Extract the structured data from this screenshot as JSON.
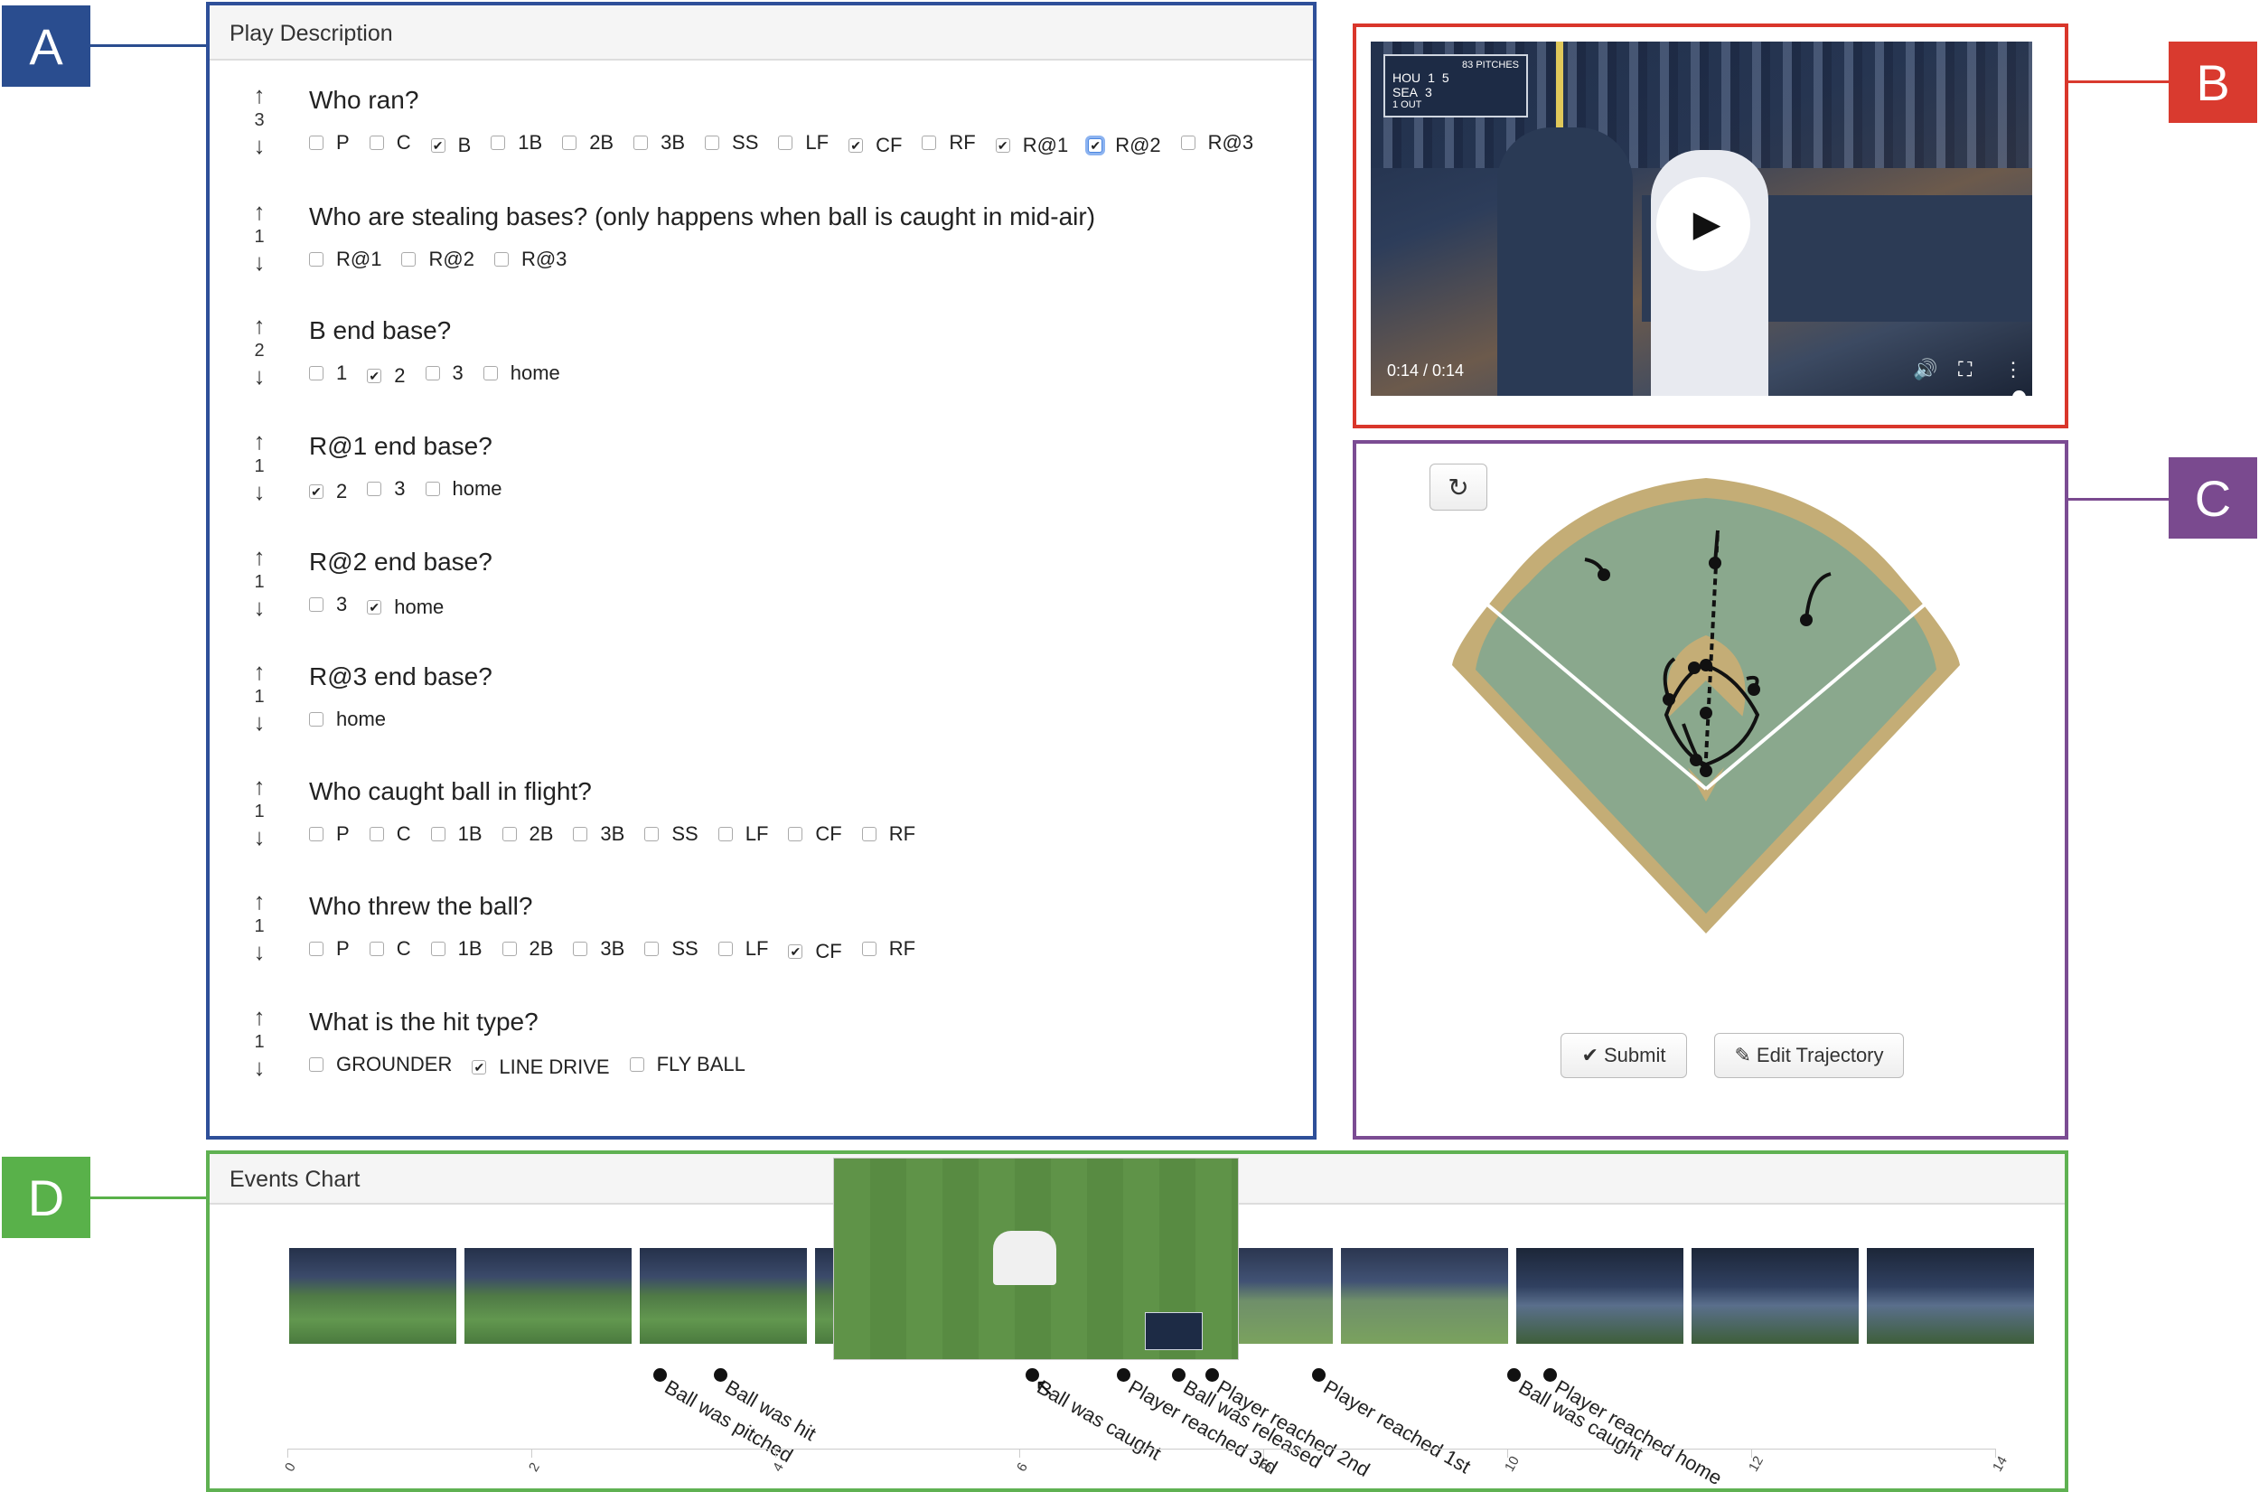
{
  "tags": {
    "a": "A",
    "b": "B",
    "c": "C",
    "d": "D"
  },
  "play_description": {
    "title": "Play Description",
    "questions": [
      {
        "title": "Who ran?",
        "count": "3",
        "options": [
          {
            "label": "P",
            "checked": false
          },
          {
            "label": "C",
            "checked": false
          },
          {
            "label": "B",
            "checked": true
          },
          {
            "label": "1B",
            "checked": false
          },
          {
            "label": "2B",
            "checked": false
          },
          {
            "label": "3B",
            "checked": false
          },
          {
            "label": "SS",
            "checked": false
          },
          {
            "label": "LF",
            "checked": false
          },
          {
            "label": "CF",
            "checked": true
          },
          {
            "label": "RF",
            "checked": false
          },
          {
            "label": "R@1",
            "checked": true
          },
          {
            "label": "R@2",
            "checked": true,
            "focused": true
          },
          {
            "label": "R@3",
            "checked": false
          }
        ]
      },
      {
        "title": "Who are stealing bases? (only happens when ball is caught in mid-air)",
        "count": "1",
        "options": [
          {
            "label": "R@1",
            "checked": false
          },
          {
            "label": "R@2",
            "checked": false
          },
          {
            "label": "R@3",
            "checked": false
          }
        ]
      },
      {
        "title": "B end base?",
        "count": "2",
        "options": [
          {
            "label": "1",
            "checked": false
          },
          {
            "label": "2",
            "checked": true
          },
          {
            "label": "3",
            "checked": false
          },
          {
            "label": "home",
            "checked": false
          }
        ]
      },
      {
        "title": "R@1 end base?",
        "count": "1",
        "options": [
          {
            "label": "2",
            "checked": true
          },
          {
            "label": "3",
            "checked": false
          },
          {
            "label": "home",
            "checked": false
          }
        ]
      },
      {
        "title": "R@2 end base?",
        "count": "1",
        "options": [
          {
            "label": "3",
            "checked": false
          },
          {
            "label": "home",
            "checked": true
          }
        ]
      },
      {
        "title": "R@3 end base?",
        "count": "1",
        "options": [
          {
            "label": "home",
            "checked": false
          }
        ]
      },
      {
        "title": "Who caught ball in flight?",
        "count": "1",
        "options": [
          {
            "label": "P",
            "checked": false
          },
          {
            "label": "C",
            "checked": false
          },
          {
            "label": "1B",
            "checked": false
          },
          {
            "label": "2B",
            "checked": false
          },
          {
            "label": "3B",
            "checked": false
          },
          {
            "label": "SS",
            "checked": false
          },
          {
            "label": "LF",
            "checked": false
          },
          {
            "label": "CF",
            "checked": false
          },
          {
            "label": "RF",
            "checked": false
          }
        ]
      },
      {
        "title": "Who threw the ball?",
        "count": "1",
        "options": [
          {
            "label": "P",
            "checked": false
          },
          {
            "label": "C",
            "checked": false
          },
          {
            "label": "1B",
            "checked": false
          },
          {
            "label": "2B",
            "checked": false
          },
          {
            "label": "3B",
            "checked": false
          },
          {
            "label": "SS",
            "checked": false
          },
          {
            "label": "LF",
            "checked": false
          },
          {
            "label": "CF",
            "checked": true
          },
          {
            "label": "RF",
            "checked": false
          }
        ]
      },
      {
        "title": "What is the hit type?",
        "count": "1",
        "options": [
          {
            "label": "GROUNDER",
            "checked": false
          },
          {
            "label": "LINE DRIVE",
            "checked": true
          },
          {
            "label": "FLY BALL",
            "checked": false
          }
        ]
      }
    ]
  },
  "video": {
    "time": "0:14 / 0:14",
    "progress": 1.0,
    "scorebug": {
      "label": "83 PITCHES",
      "team1": "HOU",
      "score1": "1",
      "team2": "SEA",
      "score2": "3",
      "inning": "5",
      "outs": "1 OUT"
    }
  },
  "field": {
    "refresh_icon": "refresh-icon",
    "submit_label": "Submit",
    "edit_label": "Edit Trajectory",
    "colors": {
      "dirt": "#c4ad76",
      "grass": "#8aa88d",
      "line": "#ffffff"
    }
  },
  "events_chart": {
    "title": "Events Chart",
    "thumbnail_count": 10,
    "events": [
      {
        "label": "Ball was pitched",
        "t": 3.05
      },
      {
        "label": "Ball was hit",
        "t": 3.55
      },
      {
        "label": "Ball was caught",
        "t": 6.1
      },
      {
        "label": "Player reached 3rd",
        "t": 6.85
      },
      {
        "label": "Ball was released",
        "t": 7.3
      },
      {
        "label": "Player reached 2nd",
        "t": 7.58
      },
      {
        "label": "Player reached 1st",
        "t": 8.45
      },
      {
        "label": "Ball was caught",
        "t": 10.05
      },
      {
        "label": "Player reached home",
        "t": 10.35
      }
    ],
    "axis_ticks": [
      "0",
      "2",
      "4",
      "6",
      "8",
      "10",
      "12",
      "14"
    ]
  }
}
